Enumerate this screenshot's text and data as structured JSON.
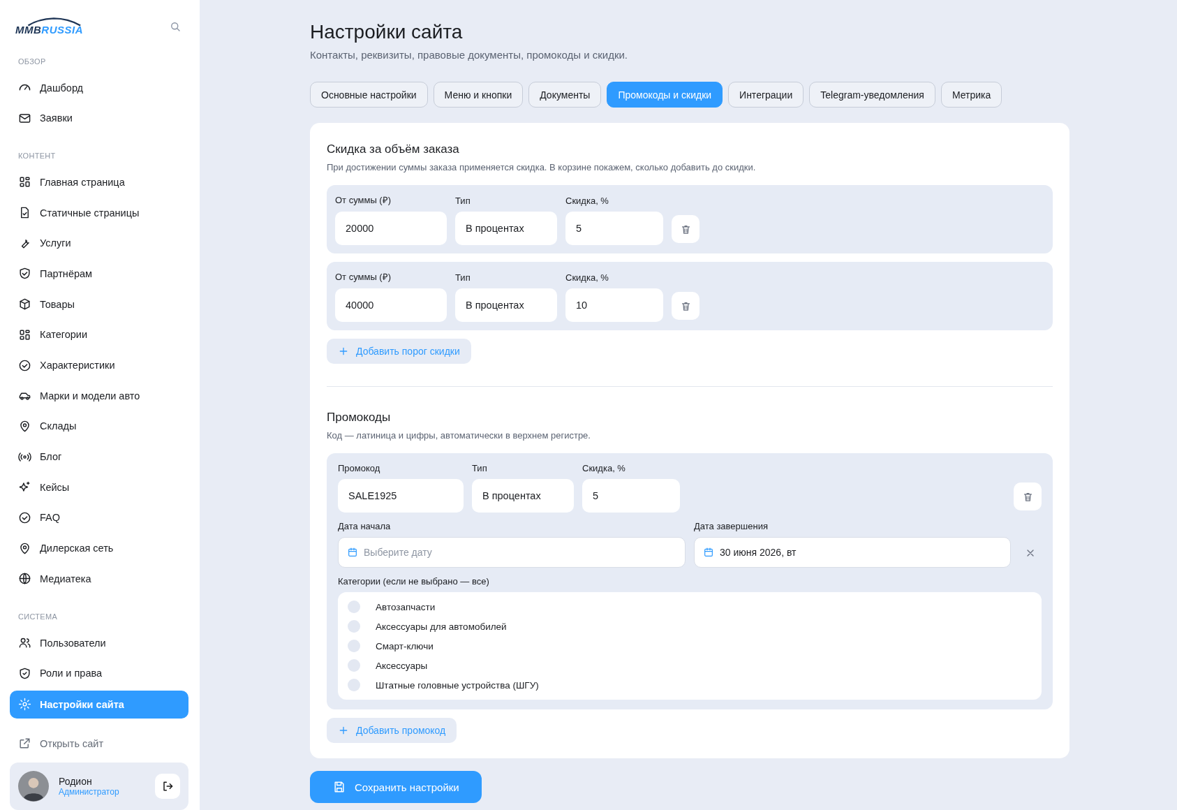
{
  "sidebar": {
    "logo": [
      "MMB",
      "RUSSIA"
    ],
    "sections": [
      {
        "title": "ОБЗОР",
        "items": [
          {
            "label": "Дашборд",
            "selected": false
          },
          {
            "label": "Заявки",
            "selected": false
          }
        ]
      },
      {
        "title": "КОНТЕНТ",
        "items": [
          {
            "label": "Главная страница",
            "selected": false
          },
          {
            "label": "Статичные страницы",
            "selected": false
          },
          {
            "label": "Услуги",
            "selected": false
          },
          {
            "label": "Партнёрам",
            "selected": false
          },
          {
            "label": "Товары",
            "selected": false
          },
          {
            "label": "Категории",
            "selected": false
          },
          {
            "label": "Характеристики",
            "selected": false
          },
          {
            "label": "Марки и модели авто",
            "selected": false
          },
          {
            "label": "Склады",
            "selected": false
          },
          {
            "label": "Блог",
            "selected": false
          },
          {
            "label": "Кейсы",
            "selected": false
          },
          {
            "label": "FAQ",
            "selected": false
          },
          {
            "label": "Дилерская сеть",
            "selected": false
          },
          {
            "label": "Медиатека",
            "selected": false
          }
        ]
      },
      {
        "title": "СИСТЕМА",
        "items": [
          {
            "label": "Пользователи",
            "selected": false
          },
          {
            "label": "Роли и права",
            "selected": false
          },
          {
            "label": "Настройки сайта",
            "selected": true
          }
        ]
      }
    ],
    "open_site": "Открыть сайт",
    "user": {
      "name": "Родион",
      "role": "Администратор"
    }
  },
  "page": {
    "title": "Настройки сайта",
    "subtitle": "Контакты, реквизиты, правовые документы, промокоды и скидки."
  },
  "tabs": [
    {
      "label": "Основные настройки",
      "selected": false
    },
    {
      "label": "Меню и кнопки",
      "selected": false
    },
    {
      "label": "Документы",
      "selected": false
    },
    {
      "label": "Промокоды и скидки",
      "selected": true
    },
    {
      "label": "Интеграции",
      "selected": false
    },
    {
      "label": "Telegram-уведомления",
      "selected": false
    },
    {
      "label": "Метрика",
      "selected": false
    }
  ],
  "volume_discount": {
    "title": "Скидка за объём заказа",
    "description": "При достижении суммы заказа применяется скидка. В корзине покажем, сколько добавить до скидки.",
    "rows": [
      {
        "fields": [
          {
            "label": "От суммы (₽)",
            "value": "20000"
          },
          {
            "label": "Тип",
            "value": "В процентах"
          },
          {
            "label": "Скидка, %",
            "value": "5"
          }
        ]
      },
      {
        "fields": [
          {
            "label": "От суммы (₽)",
            "value": "40000"
          },
          {
            "label": "Тип",
            "value": "В процентах"
          },
          {
            "label": "Скидка, %",
            "value": "10"
          }
        ]
      }
    ],
    "add_button": "Добавить порог скидки"
  },
  "promocodes": {
    "title": "Промокоды",
    "description": "Код — латиница и цифры, автоматически в верхнем регистре.",
    "items": [
      {
        "fields": [
          {
            "label": "Промокод",
            "value": "SALE1925"
          },
          {
            "label": "Тип",
            "value": "В процентах"
          },
          {
            "label": "Скидка, %",
            "value": "5"
          }
        ],
        "start_date": {
          "label": "Дата начала",
          "placeholder": "Выберите дату"
        },
        "end_date": {
          "label": "Дата завершения",
          "value": "30 июня 2026, вт"
        },
        "categories_label": "Категории (если не выбрано — все)",
        "categories": [
          {
            "label": "Автозапчасти",
            "checked": false
          },
          {
            "label": "Аксессуары для автомобилей",
            "checked": false
          },
          {
            "label": "Смарт-ключи",
            "checked": false
          },
          {
            "label": "Аксессуары",
            "checked": false
          },
          {
            "label": "Штатные головные устройства (ШГУ)",
            "checked": false
          }
        ]
      }
    ],
    "add_button": "Добавить промокод"
  },
  "save_button": "Сохранить настройки"
}
